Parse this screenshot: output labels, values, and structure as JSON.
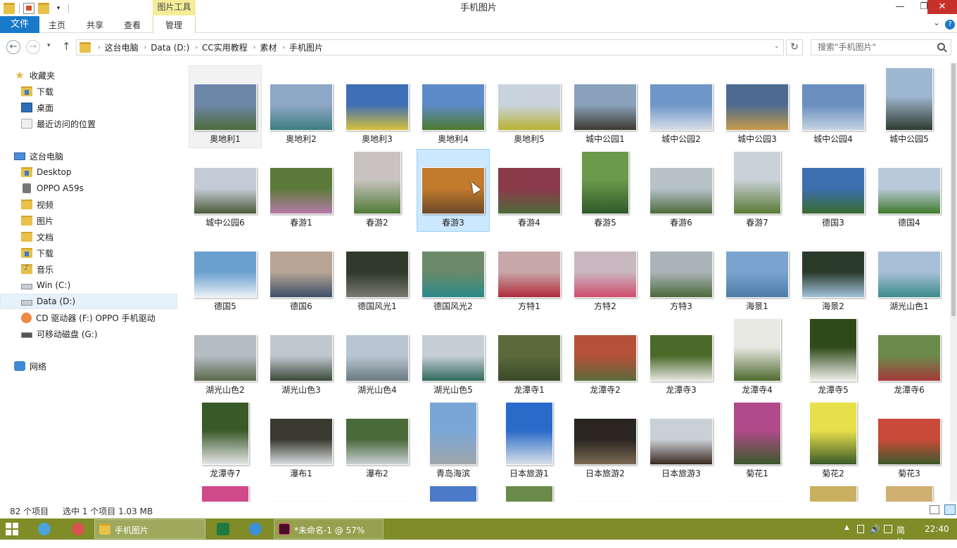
{
  "window": {
    "title": "手机图片",
    "contextual_tab": "图片工具",
    "min_glyph": "—",
    "max_glyph": "❐",
    "close_glyph": "✕"
  },
  "ribbon": {
    "file_tab": "文件",
    "tabs": [
      "主页",
      "共享",
      "查看",
      "管理"
    ],
    "expand_glyph": "⌄",
    "help_glyph": "?"
  },
  "nav": {
    "back_glyph": "←",
    "forward_glyph": "→",
    "recent_glyph": "▾",
    "up_glyph": "↑",
    "breadcrumbs": [
      "这台电脑",
      "Data (D:)",
      "CC实用教程",
      "素材",
      "手机图片"
    ],
    "crumb_sep": "›",
    "dropdown_glyph": "⌄",
    "refresh_glyph": "↻",
    "search_placeholder": "搜索\"手机图片\""
  },
  "sidebar": {
    "favorites_label": "收藏夹",
    "favorites": [
      "下载",
      "桌面",
      "最近访问的位置"
    ],
    "pc_label": "这台电脑",
    "pc_items": [
      "Desktop",
      "OPPO A59s",
      "视频",
      "图片",
      "文档",
      "下载",
      "音乐",
      "Win (C:)",
      "Data (D:)",
      "CD 驱动器 (F:) OPPO 手机驱动",
      "可移动磁盘 (G:)"
    ],
    "network_label": "网络",
    "expand_glyph": "▸"
  },
  "files": [
    {
      "name": "奥地利1",
      "colors": [
        "#6d87a8",
        "#4e6b3a"
      ],
      "orient": "l"
    },
    {
      "name": "奥地利2",
      "colors": [
        "#8fa7c6",
        "#3c7d80"
      ],
      "orient": "l"
    },
    {
      "name": "奥地利3",
      "colors": [
        "#3f6fb5",
        "#d6c23a"
      ],
      "orient": "l"
    },
    {
      "name": "奥地利4",
      "colors": [
        "#5d8bc9",
        "#4c7a2c"
      ],
      "orient": "l"
    },
    {
      "name": "奥地利5",
      "colors": [
        "#c9d3de",
        "#b9b232"
      ],
      "orient": "l"
    },
    {
      "name": "城中公园1",
      "colors": [
        "#8aa1bb",
        "#3b3a30"
      ],
      "orient": "l"
    },
    {
      "name": "城中公园2",
      "colors": [
        "#6f97c9",
        "#d7dde6"
      ],
      "orient": "l"
    },
    {
      "name": "城中公园3",
      "colors": [
        "#4d6b90",
        "#c79a4a"
      ],
      "orient": "l"
    },
    {
      "name": "城中公园4",
      "colors": [
        "#6a8fbe",
        "#c6d3e3"
      ],
      "orient": "l"
    },
    {
      "name": "城中公园5",
      "colors": [
        "#9fb8d2",
        "#2f3b2f"
      ],
      "orient": "p"
    },
    {
      "name": "城中公园6",
      "colors": [
        "#c3ccd6",
        "#4b5a3a"
      ],
      "orient": "l"
    },
    {
      "name": "春游1",
      "colors": [
        "#5d7a3a",
        "#b57aa8"
      ],
      "orient": "l"
    },
    {
      "name": "春游2",
      "colors": [
        "#c8c3c0",
        "#4f7b35"
      ],
      "orient": "p"
    },
    {
      "name": "春游3",
      "colors": [
        "#c27a2c",
        "#6b4a2a"
      ],
      "orient": "l"
    },
    {
      "name": "春游4",
      "colors": [
        "#8a3a4a",
        "#4f6b3a"
      ],
      "orient": "l"
    },
    {
      "name": "春游5",
      "colors": [
        "#6a9a4a",
        "#2f5a2a"
      ],
      "orient": "p"
    },
    {
      "name": "春游6",
      "colors": [
        "#b8c2c9",
        "#4b6a3a"
      ],
      "orient": "l"
    },
    {
      "name": "春游7",
      "colors": [
        "#c9d1d9",
        "#5a7a35"
      ],
      "orient": "p"
    },
    {
      "name": "德国3",
      "colors": [
        "#3c6fb0",
        "#3a6a2e"
      ],
      "orient": "l"
    },
    {
      "name": "德国4",
      "colors": [
        "#b9c9d9",
        "#3f7a2a"
      ],
      "orient": "l"
    },
    {
      "name": "德国5",
      "colors": [
        "#6aa0d0",
        "#e9f0f5"
      ],
      "orient": "l"
    },
    {
      "name": "德国6",
      "colors": [
        "#b8a494",
        "#3b4f6a"
      ],
      "orient": "l"
    },
    {
      "name": "德国风光1",
      "colors": [
        "#2f3a2a",
        "#7a7a70"
      ],
      "orient": "l"
    },
    {
      "name": "德国风光2",
      "colors": [
        "#6a8a6a",
        "#2a8a8a"
      ],
      "orient": "l"
    },
    {
      "name": "方特1",
      "colors": [
        "#c7a7a7",
        "#b02a3a"
      ],
      "orient": "l"
    },
    {
      "name": "方特2",
      "colors": [
        "#c9b8c0",
        "#d04a6a"
      ],
      "orient": "l"
    },
    {
      "name": "方特3",
      "colors": [
        "#aab3b8",
        "#4a6a3a"
      ],
      "orient": "l"
    },
    {
      "name": "海景1",
      "colors": [
        "#7aa3cf",
        "#4d7ba8"
      ],
      "orient": "l"
    },
    {
      "name": "海景2",
      "colors": [
        "#2a3a2a",
        "#a3c2db"
      ],
      "orient": "l"
    },
    {
      "name": "湖光山色1",
      "colors": [
        "#a7bfd6",
        "#3a8a8a"
      ],
      "orient": "l"
    },
    {
      "name": "湖光山色2",
      "colors": [
        "#b4bcc4",
        "#5a6a4a"
      ],
      "orient": "l"
    },
    {
      "name": "湖光山色3",
      "colors": [
        "#c0c8cf",
        "#3a4a3a"
      ],
      "orient": "l"
    },
    {
      "name": "湖光山色4",
      "colors": [
        "#b9c6d2",
        "#6a7a80"
      ],
      "orient": "l"
    },
    {
      "name": "湖光山色5",
      "colors": [
        "#c6ced6",
        "#2f6a5a"
      ],
      "orient": "l"
    },
    {
      "name": "龙潭寺1",
      "colors": [
        "#5a6a3a",
        "#3a4a2a"
      ],
      "orient": "l"
    },
    {
      "name": "龙潭寺2",
      "colors": [
        "#b5503a",
        "#5a6a3a"
      ],
      "orient": "l"
    },
    {
      "name": "龙潭寺3",
      "colors": [
        "#4a6a2a",
        "#e6e6e0"
      ],
      "orient": "l"
    },
    {
      "name": "龙潭寺4",
      "colors": [
        "#e9e9e4",
        "#4f6a2f"
      ],
      "orient": "p"
    },
    {
      "name": "龙潭寺5",
      "colors": [
        "#2f4a1a",
        "#f0f0ea"
      ],
      "orient": "p"
    },
    {
      "name": "龙潭寺6",
      "colors": [
        "#6a8a4a",
        "#a53a3a"
      ],
      "orient": "l"
    },
    {
      "name": "龙潭寺7",
      "colors": [
        "#3a5a2a",
        "#e6e6e6"
      ],
      "orient": "p"
    },
    {
      "name": "瀑布1",
      "colors": [
        "#3a3a30",
        "#d9dde0"
      ],
      "orient": "l"
    },
    {
      "name": "瀑布2",
      "colors": [
        "#4a6a3a",
        "#c9d0d5"
      ],
      "orient": "l"
    },
    {
      "name": "青岛海滨",
      "colors": [
        "#7aa6d6",
        "#a0a6ac"
      ],
      "orient": "p"
    },
    {
      "name": "日本旅游1",
      "colors": [
        "#2a6ac9",
        "#d8e0e8"
      ],
      "orient": "p"
    },
    {
      "name": "日本旅游2",
      "colors": [
        "#2a2520",
        "#7a6a55"
      ],
      "orient": "l"
    },
    {
      "name": "日本旅游3",
      "colors": [
        "#c9d0d6",
        "#3a2a20"
      ],
      "orient": "l"
    },
    {
      "name": "菊花1",
      "colors": [
        "#b04a8a",
        "#3a5a2a"
      ],
      "orient": "p"
    },
    {
      "name": "菊花2",
      "colors": [
        "#e8e04a",
        "#3a5a2a"
      ],
      "orient": "p"
    },
    {
      "name": "菊花3",
      "colors": [
        "#c94a3a",
        "#3a5a2a"
      ],
      "orient": "l"
    },
    {
      "name": "",
      "colors": [
        "#d04a8a",
        "#3a6a2a"
      ],
      "orient": "p"
    },
    {
      "name": "",
      "colors": [
        "#e7a0c9",
        "#4a6a2a"
      ],
      "orient": "l"
    },
    {
      "name": "",
      "colors": [
        "#c9c0b0",
        "#e6e0d5"
      ],
      "orient": "l"
    },
    {
      "name": "",
      "colors": [
        "#4a7ac9",
        "#8aa0b0"
      ],
      "orient": "p"
    },
    {
      "name": "",
      "colors": [
        "#6a8a4a",
        "#c9d0d5"
      ],
      "orient": "p"
    },
    {
      "name": "",
      "colors": [
        "#2a2a2a",
        "#3a3a3a"
      ],
      "orient": "l"
    },
    {
      "name": "",
      "colors": [
        "#d9a030",
        "#f0e0c0"
      ],
      "orient": "l"
    },
    {
      "name": "",
      "colors": [
        "#c94a6a",
        "#e0d0d5"
      ],
      "orient": "l"
    },
    {
      "name": "",
      "colors": [
        "#c9b060",
        "#e8e0b0"
      ],
      "orient": "p"
    },
    {
      "name": "",
      "colors": [
        "#d0b070",
        "#7a9ac9"
      ],
      "orient": "p"
    }
  ],
  "status": {
    "count": "82 个项目",
    "selection": "选中 1 个项目  1.03 MB"
  },
  "taskbar": {
    "explorer_label": "手机图片",
    "indesign_label": "*未命名-1 @ 57%",
    "ime_label": "简体",
    "clock": "22:40",
    "tray_expand": "▲",
    "tray_volume": "🔊"
  },
  "colors": {
    "accent": "#1979ca",
    "selection": "#cce8ff",
    "taskbar": "#7f8c28",
    "close": "#c7312c"
  }
}
